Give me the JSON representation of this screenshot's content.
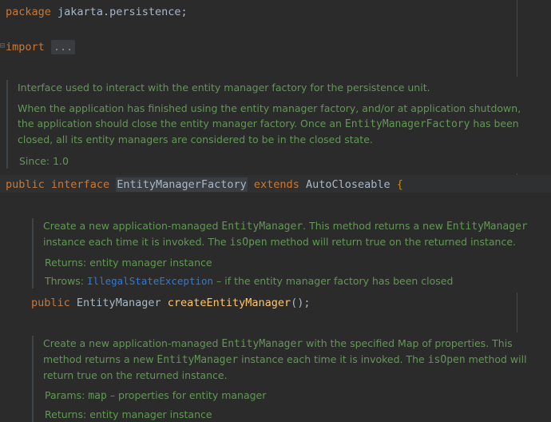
{
  "code": {
    "package_kw": "package",
    "package_name": "jakarta.persistence;",
    "import_kw": "import",
    "import_fold": "...",
    "decl_public": "public",
    "decl_interface": "interface",
    "decl_name": "EntityManagerFactory",
    "decl_extends": "extends",
    "decl_super": "AutoCloseable",
    "decl_brace": "{",
    "m1_public": "public",
    "m1_type": "EntityManager",
    "m1_name": "createEntityManager",
    "m1_rest": "();"
  },
  "class_doc": {
    "p1": "Interface used to interact with the entity manager factory for the persistence unit.",
    "p2a": "When the application has finished using the entity manager factory, and/or at application shutdown, the application should close the entity manager factory. Once an ",
    "p2code": "EntityManagerFactory",
    "p2b": " has been closed, all its entity managers are considered to be in the closed state.",
    "since_label": "Since:",
    "since_value": "1.0"
  },
  "m1_doc": {
    "a": "Create a new application-managed ",
    "code1": "EntityManager",
    "b": ". This method returns a new ",
    "code2": "EntityManager",
    "c": " instance each time it is invoked. The ",
    "code3": "isOpen",
    "d": " method will return true on the returned instance.",
    "returns_label": "Returns:",
    "returns_value": "entity manager instance",
    "throws_label": "Throws:",
    "throws_link": "IllegalStateException",
    "throws_rest": " – if the entity manager factory has been closed"
  },
  "m2_doc": {
    "a": "Create a new application-managed ",
    "code1": "EntityManager",
    "b": " with the specified Map of properties. This method returns a new ",
    "code2": "EntityManager",
    "c": " instance each time it is invoked. The ",
    "code3": "isOpen",
    "d": " method will return true on the returned instance.",
    "params_label": "Params:",
    "params_name": "map",
    "params_rest": " – properties for entity manager",
    "returns_label": "Returns:",
    "returns_value": "entity manager instance"
  }
}
